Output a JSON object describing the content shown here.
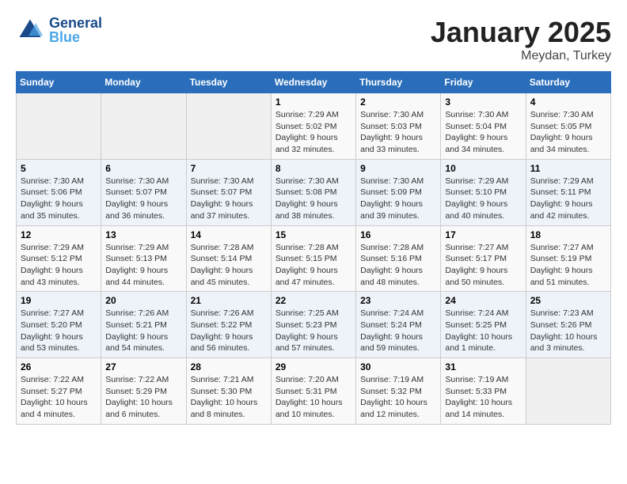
{
  "header": {
    "logo_line1": "General",
    "logo_line2": "Blue",
    "month": "January 2025",
    "location": "Meydan, Turkey"
  },
  "weekdays": [
    "Sunday",
    "Monday",
    "Tuesday",
    "Wednesday",
    "Thursday",
    "Friday",
    "Saturday"
  ],
  "weeks": [
    [
      {
        "day": "",
        "info": ""
      },
      {
        "day": "",
        "info": ""
      },
      {
        "day": "",
        "info": ""
      },
      {
        "day": "1",
        "info": "Sunrise: 7:29 AM\nSunset: 5:02 PM\nDaylight: 9 hours and 32 minutes."
      },
      {
        "day": "2",
        "info": "Sunrise: 7:30 AM\nSunset: 5:03 PM\nDaylight: 9 hours and 33 minutes."
      },
      {
        "day": "3",
        "info": "Sunrise: 7:30 AM\nSunset: 5:04 PM\nDaylight: 9 hours and 34 minutes."
      },
      {
        "day": "4",
        "info": "Sunrise: 7:30 AM\nSunset: 5:05 PM\nDaylight: 9 hours and 34 minutes."
      }
    ],
    [
      {
        "day": "5",
        "info": "Sunrise: 7:30 AM\nSunset: 5:06 PM\nDaylight: 9 hours and 35 minutes."
      },
      {
        "day": "6",
        "info": "Sunrise: 7:30 AM\nSunset: 5:07 PM\nDaylight: 9 hours and 36 minutes."
      },
      {
        "day": "7",
        "info": "Sunrise: 7:30 AM\nSunset: 5:07 PM\nDaylight: 9 hours and 37 minutes."
      },
      {
        "day": "8",
        "info": "Sunrise: 7:30 AM\nSunset: 5:08 PM\nDaylight: 9 hours and 38 minutes."
      },
      {
        "day": "9",
        "info": "Sunrise: 7:30 AM\nSunset: 5:09 PM\nDaylight: 9 hours and 39 minutes."
      },
      {
        "day": "10",
        "info": "Sunrise: 7:29 AM\nSunset: 5:10 PM\nDaylight: 9 hours and 40 minutes."
      },
      {
        "day": "11",
        "info": "Sunrise: 7:29 AM\nSunset: 5:11 PM\nDaylight: 9 hours and 42 minutes."
      }
    ],
    [
      {
        "day": "12",
        "info": "Sunrise: 7:29 AM\nSunset: 5:12 PM\nDaylight: 9 hours and 43 minutes."
      },
      {
        "day": "13",
        "info": "Sunrise: 7:29 AM\nSunset: 5:13 PM\nDaylight: 9 hours and 44 minutes."
      },
      {
        "day": "14",
        "info": "Sunrise: 7:28 AM\nSunset: 5:14 PM\nDaylight: 9 hours and 45 minutes."
      },
      {
        "day": "15",
        "info": "Sunrise: 7:28 AM\nSunset: 5:15 PM\nDaylight: 9 hours and 47 minutes."
      },
      {
        "day": "16",
        "info": "Sunrise: 7:28 AM\nSunset: 5:16 PM\nDaylight: 9 hours and 48 minutes."
      },
      {
        "day": "17",
        "info": "Sunrise: 7:27 AM\nSunset: 5:17 PM\nDaylight: 9 hours and 50 minutes."
      },
      {
        "day": "18",
        "info": "Sunrise: 7:27 AM\nSunset: 5:19 PM\nDaylight: 9 hours and 51 minutes."
      }
    ],
    [
      {
        "day": "19",
        "info": "Sunrise: 7:27 AM\nSunset: 5:20 PM\nDaylight: 9 hours and 53 minutes."
      },
      {
        "day": "20",
        "info": "Sunrise: 7:26 AM\nSunset: 5:21 PM\nDaylight: 9 hours and 54 minutes."
      },
      {
        "day": "21",
        "info": "Sunrise: 7:26 AM\nSunset: 5:22 PM\nDaylight: 9 hours and 56 minutes."
      },
      {
        "day": "22",
        "info": "Sunrise: 7:25 AM\nSunset: 5:23 PM\nDaylight: 9 hours and 57 minutes."
      },
      {
        "day": "23",
        "info": "Sunrise: 7:24 AM\nSunset: 5:24 PM\nDaylight: 9 hours and 59 minutes."
      },
      {
        "day": "24",
        "info": "Sunrise: 7:24 AM\nSunset: 5:25 PM\nDaylight: 10 hours and 1 minute."
      },
      {
        "day": "25",
        "info": "Sunrise: 7:23 AM\nSunset: 5:26 PM\nDaylight: 10 hours and 3 minutes."
      }
    ],
    [
      {
        "day": "26",
        "info": "Sunrise: 7:22 AM\nSunset: 5:27 PM\nDaylight: 10 hours and 4 minutes."
      },
      {
        "day": "27",
        "info": "Sunrise: 7:22 AM\nSunset: 5:29 PM\nDaylight: 10 hours and 6 minutes."
      },
      {
        "day": "28",
        "info": "Sunrise: 7:21 AM\nSunset: 5:30 PM\nDaylight: 10 hours and 8 minutes."
      },
      {
        "day": "29",
        "info": "Sunrise: 7:20 AM\nSunset: 5:31 PM\nDaylight: 10 hours and 10 minutes."
      },
      {
        "day": "30",
        "info": "Sunrise: 7:19 AM\nSunset: 5:32 PM\nDaylight: 10 hours and 12 minutes."
      },
      {
        "day": "31",
        "info": "Sunrise: 7:19 AM\nSunset: 5:33 PM\nDaylight: 10 hours and 14 minutes."
      },
      {
        "day": "",
        "info": ""
      }
    ]
  ]
}
